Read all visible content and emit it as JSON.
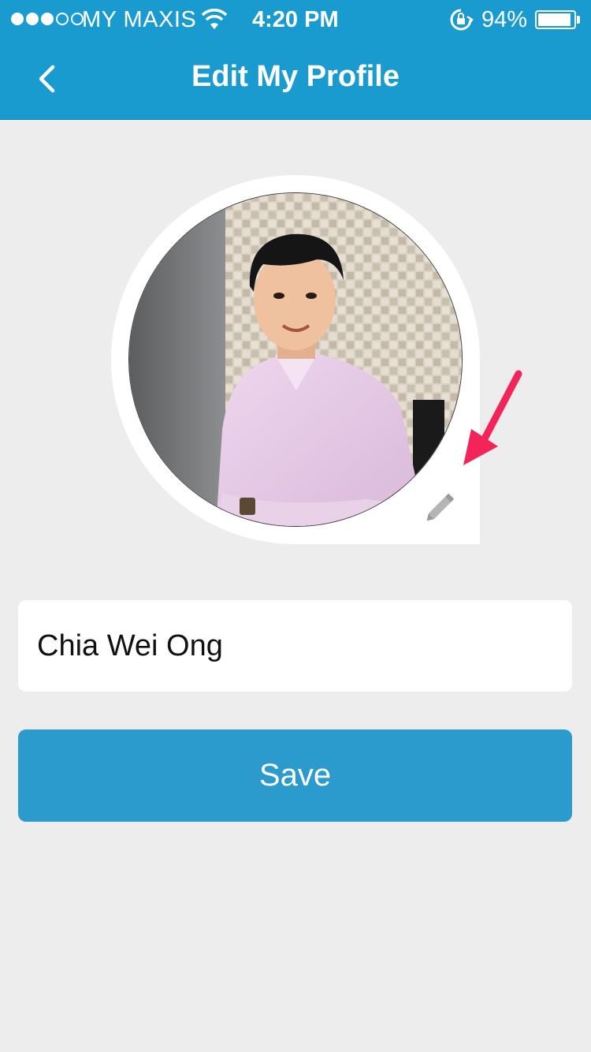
{
  "status_bar": {
    "signal_bars_filled": 3,
    "signal_bars_total": 5,
    "carrier": "MY MAXIS",
    "wifi_icon": "wifi-icon",
    "time": "4:20 PM",
    "rotation_lock_icon": "rotation-lock-icon",
    "battery_percent": "94%",
    "battery_level": 0.94
  },
  "header": {
    "back_icon": "chevron-left-icon",
    "title": "Edit My Profile"
  },
  "profile": {
    "avatar_description": "profile-photo",
    "edit_icon": "pencil-icon",
    "annotation_icon": "arrow-annotation-icon"
  },
  "form": {
    "name_value": "Chia Wei Ong",
    "save_label": "Save"
  },
  "colors": {
    "header_bg": "#1a9bd0",
    "page_bg": "#ededed",
    "button_bg": "#2a9bcc",
    "arrow": "#f2245a"
  }
}
